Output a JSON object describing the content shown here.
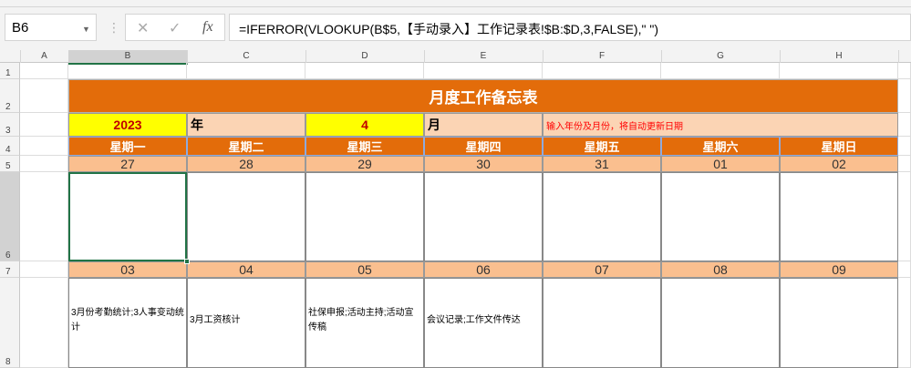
{
  "name_box": "B6",
  "formula": "=IFERROR(VLOOKUP(B$5,【手动录入】工作记录表!$B:$D,3,FALSE),\" \")",
  "formula_icons": [
    "cancel-icon",
    "enter-icon",
    "function-icon"
  ],
  "columns": [
    "A",
    "B",
    "C",
    "D",
    "E",
    "F",
    "G",
    "H"
  ],
  "rows": [
    "1",
    "2",
    "3",
    "4",
    "5",
    "6",
    "7",
    "8"
  ],
  "title": "月度工作备忘表",
  "year": "2023",
  "year_label": "年",
  "month": "4",
  "month_label": "月",
  "hint": "输入年份及月份，将自动更新日期",
  "weekdays": [
    "星期一",
    "星期二",
    "星期三",
    "星期四",
    "星期五",
    "星期六",
    "星期日"
  ],
  "week1_dates": [
    "27",
    "28",
    "29",
    "30",
    "31",
    "01",
    "02"
  ],
  "week1_notes": [
    "",
    "",
    "",
    "",
    "",
    "",
    ""
  ],
  "week2_dates": [
    "03",
    "04",
    "05",
    "06",
    "07",
    "08",
    "09"
  ],
  "week2_notes": [
    "3月份考勤统计;3人事变动统计",
    "3月工资核计",
    "社保申报;活动主持;活动宣传稿",
    "会议记录;工作文件传达",
    "",
    "",
    ""
  ],
  "colors": {
    "orange": "#e36c0a",
    "peach": "#fbd4b4",
    "date_bg": "#fabf8f",
    "yellow": "#ffff00",
    "red": "#c00000",
    "hint": "#ff0000"
  }
}
